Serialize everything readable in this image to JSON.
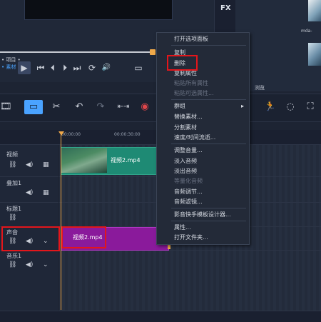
{
  "player": {
    "mode_project": "• 项目 •",
    "mode_clip": "• 素材 •",
    "play_icon": "▶",
    "prev_icon": "⏮",
    "step_back_icon": "⏴",
    "step_fwd_icon": "⏵",
    "next_icon": "⏭",
    "repeat_icon": "⟳",
    "volume_icon": "🔊",
    "aspect_icon": "▭",
    "expand_icon": "⤢"
  },
  "side": {
    "fx_label": "FX",
    "thumb_label": "mda-",
    "browse_label": "浏览"
  },
  "toolbar": {
    "storyboard_icon": "🎞",
    "timeline_icon": "▭",
    "tools_icon": "✂",
    "undo_icon": "↶",
    "redo_icon": "↷",
    "fit_icon": "⇤⇥",
    "record_icon": "◉",
    "motion_icon": "🏃",
    "mask_icon": "◌",
    "crop_icon": "⛶"
  },
  "ruler": {
    "t0": "00:00:00",
    "t1": "00:00:30:00"
  },
  "tracks": [
    {
      "name": "视频"
    },
    {
      "name": "叠加1"
    },
    {
      "name": "标题1"
    },
    {
      "name": "声音"
    },
    {
      "name": "音乐1"
    }
  ],
  "clips": {
    "video": "视频2.mp4",
    "audio": "视频2.mp4"
  },
  "context_menu": {
    "items": [
      {
        "label": "打开选项面板",
        "disabled": false
      },
      {
        "label": "复制",
        "disabled": false
      },
      {
        "label": "删除",
        "disabled": false
      },
      {
        "label": "复制属性",
        "disabled": false
      },
      {
        "label": "粘贴所有属性",
        "disabled": true
      },
      {
        "label": "粘贴可选属性...",
        "disabled": true
      },
      {
        "label": "群组",
        "disabled": false
      },
      {
        "label": "替换素材...",
        "disabled": false
      },
      {
        "label": "分割素材",
        "disabled": false
      },
      {
        "label": "速度/时间流逝...",
        "disabled": false
      },
      {
        "label": "调整音量...",
        "disabled": false
      },
      {
        "label": "淡入音频",
        "disabled": false
      },
      {
        "label": "淡出音频",
        "disabled": false
      },
      {
        "label": "等量化音频",
        "disabled": true
      },
      {
        "label": "音频调节...",
        "disabled": false
      },
      {
        "label": "音频滤镜...",
        "disabled": false
      },
      {
        "label": "影音快手模板设计器...",
        "disabled": false
      },
      {
        "label": "属性...",
        "disabled": false
      },
      {
        "label": "打开文件夹...",
        "disabled": false
      }
    ],
    "submenu_arrow": "▸"
  },
  "colors": {
    "accent": "#4aa3ff",
    "highlight": "#e3161b",
    "video_clip": "#1e8a74",
    "audio_clip": "#8a1a9b",
    "playhead": "#f0a94a"
  }
}
